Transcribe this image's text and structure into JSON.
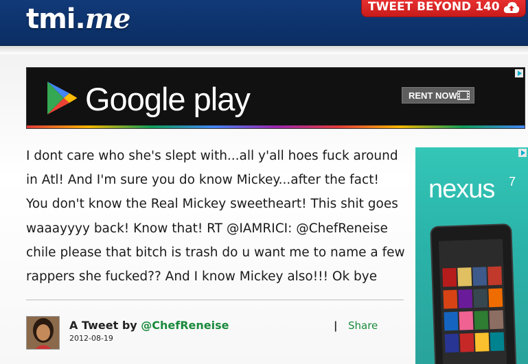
{
  "header": {
    "logo_main": "tmi.",
    "logo_suffix": "me",
    "cta_label": "TWEET BEYOND 140",
    "cta_icon": "cloud-upload-icon"
  },
  "ads": {
    "top_banner": {
      "brand_text": "Google play",
      "button_label": "RENT NOW",
      "play_icon": "google-play-icon",
      "film_icon": "film-strip-icon",
      "adchoices_icon": "adchoices-icon"
    },
    "side_banner": {
      "brand_text": "nexus",
      "brand_sup": "7",
      "adchoices_icon": "adchoices-icon"
    }
  },
  "tweet": {
    "lines": [
      "I dont care who she's slept with...all y'all hoes fuck around",
      "in Atl! And I'm sure you do know Mickey...after the fact!",
      "You don't know the Real Mickey sweetheart! This shit goes",
      "waaayyyy back! Know that! RT @IAMRICI: @ChefReneise",
      "chile please that bitch is trash do u want me to name a few",
      "rappers she fucked?? And I know Mickey also!!! Ok bye"
    ],
    "byline_prefix": "A Tweet by ",
    "author_handle": "@ChefReneise",
    "date": "2012-08-19",
    "separator": "|",
    "share_label": "Share"
  },
  "colors": {
    "header_bg": "#0f3570",
    "cta_bg": "#d92323",
    "link_green": "#1a8a3c",
    "nexus_teal": "#2fb8ad"
  }
}
